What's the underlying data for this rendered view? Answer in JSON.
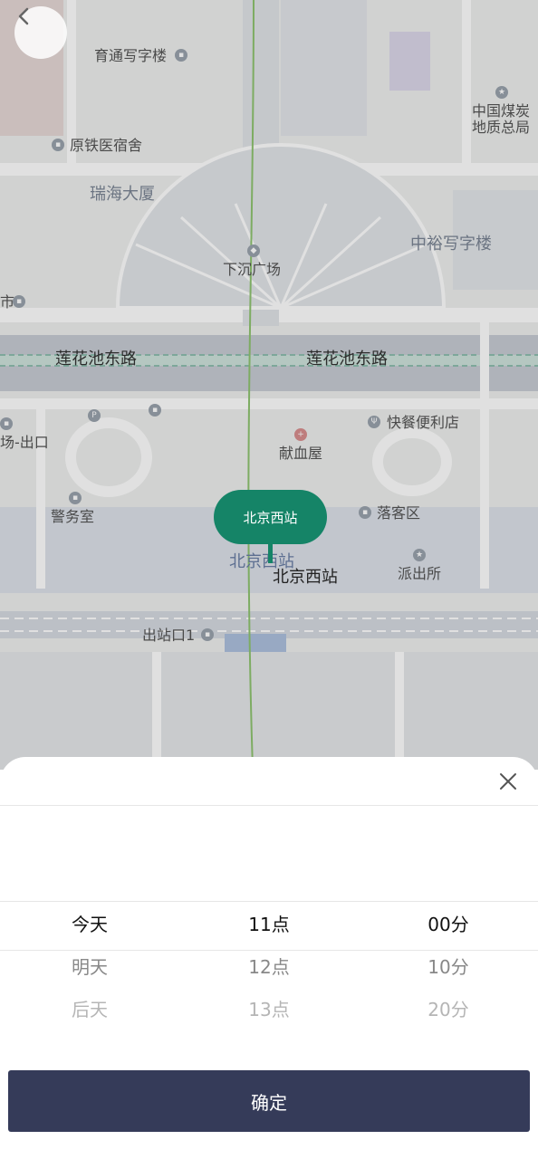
{
  "map": {
    "labels": {
      "yutong": "育通写字楼",
      "coal": "中国煤炭",
      "coal2": "地质总局",
      "yuantie": "原铁医宿舍",
      "ruihai": "瑞海大厦",
      "zhongyu": "中裕写字楼",
      "xiachen": "下沉广场",
      "shi": "市",
      "lianhua1": "莲花池东路",
      "lianhua2": "莲花池东路",
      "kuaican": "快餐便利店",
      "chukou": "场-出口",
      "xianxue": "献血屋",
      "jingwu": "警务室",
      "luoke": "落客区",
      "bjxz_map": "北京西站",
      "paichu": "派出所",
      "chuzhan": "出站口1"
    }
  },
  "marker": {
    "title": "北京西站",
    "label": "北京西站"
  },
  "picker": {
    "days": [
      "今天",
      "明天",
      "后天"
    ],
    "hours": [
      "11点",
      "12点",
      "13点"
    ],
    "minutes": [
      "00分",
      "10分",
      "20分"
    ]
  },
  "confirm_label": "确定",
  "colors": {
    "accent": "#158467",
    "button": "#353b59"
  }
}
